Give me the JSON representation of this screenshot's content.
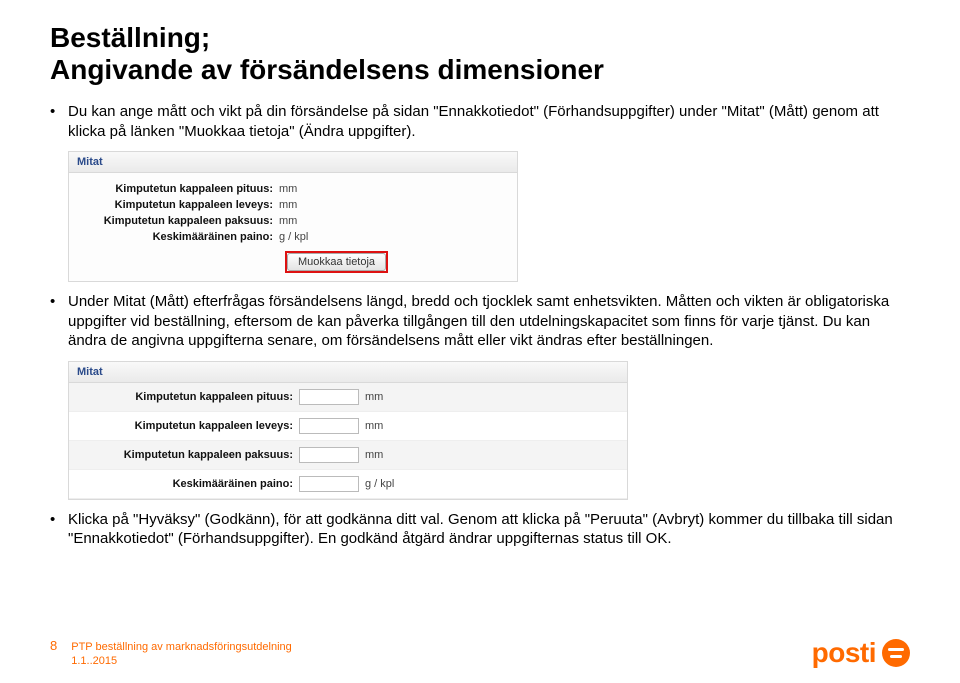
{
  "title": "Beställning;\nAngivande av försändelsens dimensioner",
  "bullets": {
    "b1": "Du kan ange mått och vikt på din försändelse på sidan \"Ennakkotiedot\" (Förhandsuppgifter) under \"Mitat\" (Mått) genom att klicka på länken \"Muokkaa tietoja\" (Ändra uppgifter).",
    "b2": "Under Mitat (Mått) efterfrågas försändelsens längd, bredd och tjocklek samt enhetsvikten. Måtten och vikten är obligatoriska uppgifter vid beställning, eftersom de kan påverka tillgången till den utdelningskapacitet som finns för varje tjänst. Du kan ändra de angivna uppgifterna senare, om försändelsens mått eller vikt ändras efter beställningen.",
    "b3": "Klicka på \"Hyväksy\" (Godkänn), för att godkänna ditt val. Genom att klicka på \"Peruuta\" (Avbryt) kommer du tillbaka till sidan \"Ennakkotiedot\" (Förhandsuppgifter). En godkänd åtgärd ändrar uppgifternas status till OK."
  },
  "panel1": {
    "heading": "Mitat",
    "rows": [
      {
        "label": "Kimputetun kappaleen pituus:",
        "unit": "mm"
      },
      {
        "label": "Kimputetun kappaleen leveys:",
        "unit": "mm"
      },
      {
        "label": "Kimputetun kappaleen paksuus:",
        "unit": "mm"
      },
      {
        "label": "Keskimääräinen paino:",
        "unit": "g / kpl"
      }
    ],
    "button": "Muokkaa tietoja"
  },
  "panel2": {
    "heading": "Mitat",
    "rows": [
      {
        "label": "Kimputetun kappaleen pituus:",
        "unit": "mm"
      },
      {
        "label": "Kimputetun kappaleen leveys:",
        "unit": "mm"
      },
      {
        "label": "Kimputetun kappaleen paksuus:",
        "unit": "mm"
      },
      {
        "label": "Keskimääräinen paino:",
        "unit": "g / kpl"
      }
    ]
  },
  "footer": {
    "page": "8",
    "line1": "PTP beställning av marknadsföringsutdelning",
    "line2": "1.1..2015",
    "logo": "posti"
  }
}
